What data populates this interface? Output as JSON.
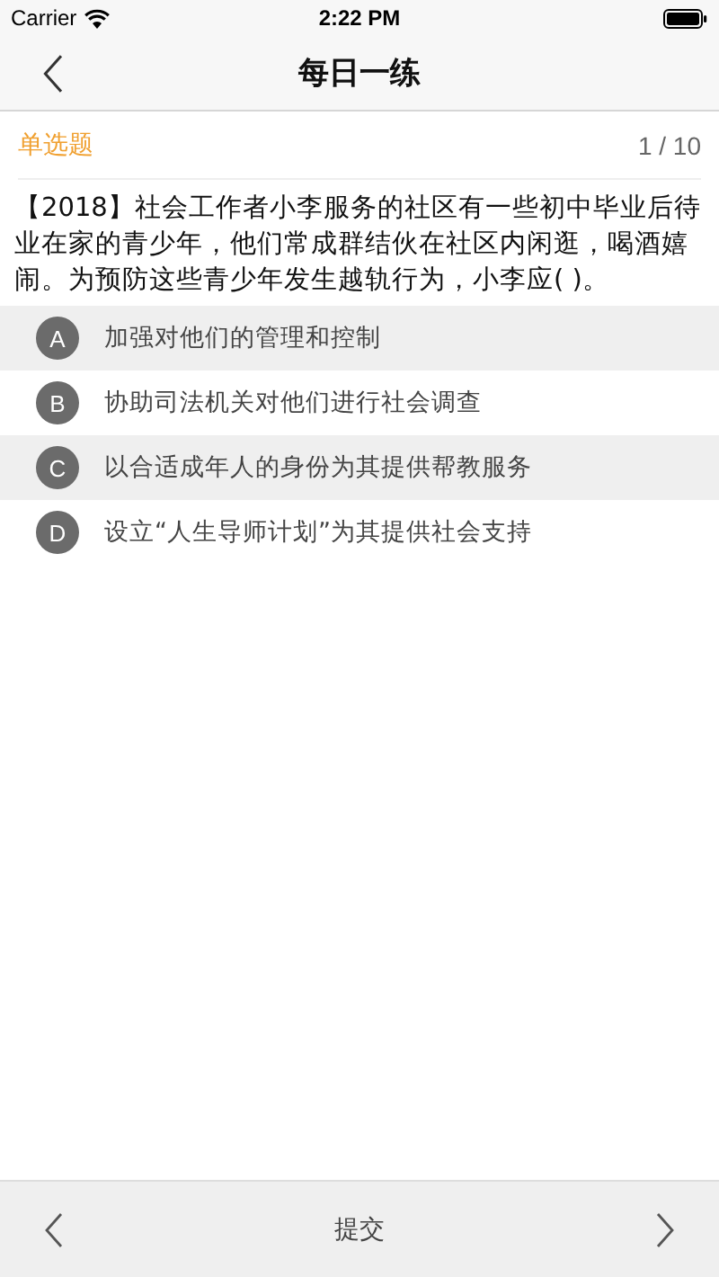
{
  "status_bar": {
    "carrier": "Carrier",
    "time": "2:22 PM"
  },
  "nav_bar": {
    "title": "每日一练"
  },
  "question": {
    "type_label": "单选题",
    "progress": "1 / 10",
    "text": "【2018】社会工作者小李服务的社区有一些初中毕业后待业在家的青少年，他们常成群结伙在社区内闲逛，喝酒嬉闹。为预防这些青少年发生越轨行为，小李应( )。"
  },
  "options": [
    {
      "letter": "A",
      "text": "加强对他们的管理和控制"
    },
    {
      "letter": "B",
      "text": "协助司法机关对他们进行社会调查"
    },
    {
      "letter": "C",
      "text": "以合适成年人的身份为其提供帮教服务"
    },
    {
      "letter": "D",
      "text": "设立“人生导师计划”为其提供社会支持"
    }
  ],
  "bottom_bar": {
    "submit": "提交"
  }
}
